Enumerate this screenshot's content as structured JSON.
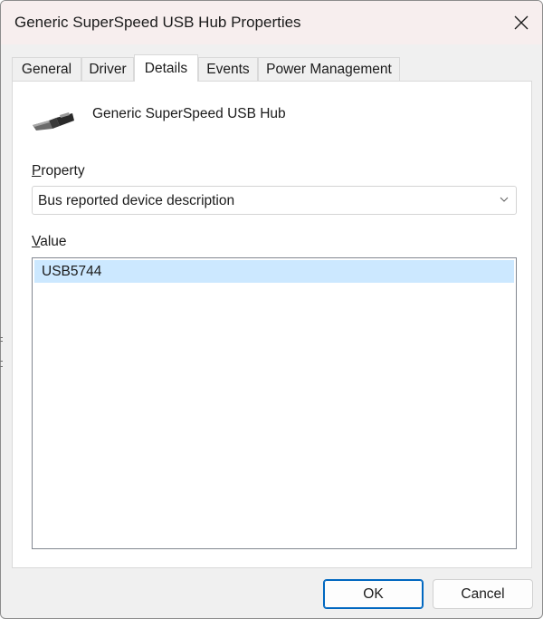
{
  "window": {
    "title": "Generic SuperSpeed USB Hub Properties"
  },
  "tabs": [
    {
      "label": "General",
      "active": false
    },
    {
      "label": "Driver",
      "active": false
    },
    {
      "label": "Details",
      "active": true
    },
    {
      "label": "Events",
      "active": false
    },
    {
      "label": "Power Management",
      "active": false
    }
  ],
  "device": {
    "name": "Generic SuperSpeed USB Hub",
    "icon": "usb-plug-icon"
  },
  "property": {
    "label_accel": "P",
    "label_rest": "roperty",
    "selected": "Bus reported device description"
  },
  "value": {
    "label_accel": "V",
    "label_rest": "alue",
    "items": [
      "USB5744"
    ]
  },
  "buttons": {
    "ok": "OK",
    "cancel": "Cancel"
  },
  "colors": {
    "title_bg": "#f7eeee",
    "selection": "#cce8ff",
    "accent": "#0067c0"
  }
}
